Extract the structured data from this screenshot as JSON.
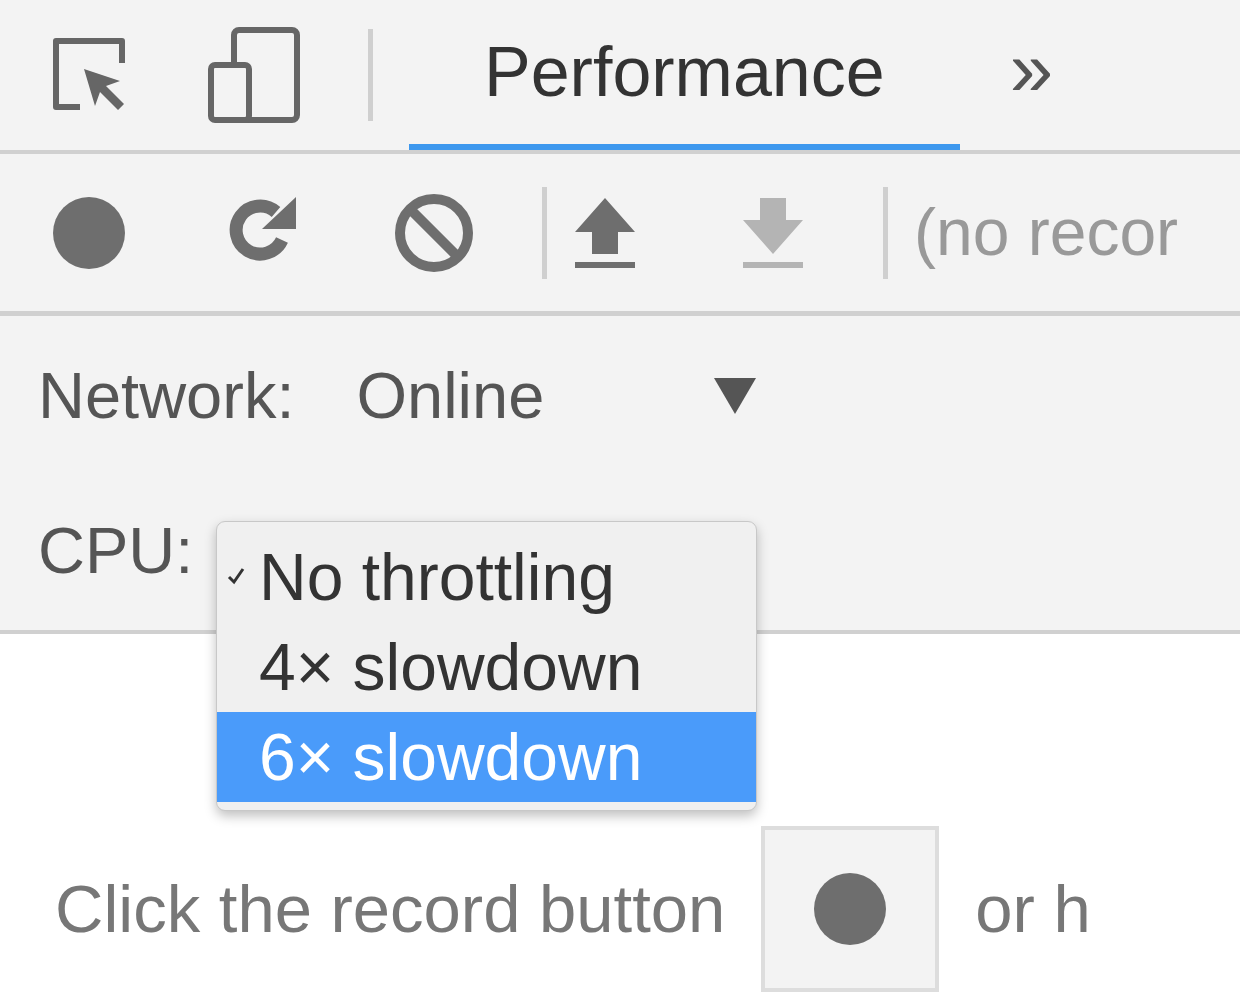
{
  "tabbar": {
    "tools": [
      {
        "kind": "inspect"
      },
      {
        "kind": "device"
      }
    ],
    "tabs": [
      {
        "label": "Performance",
        "selected": true
      }
    ],
    "more": "»"
  },
  "toolbar": {
    "groups": [
      [
        {
          "kind": "record",
          "disabled": false
        },
        {
          "kind": "reload",
          "disabled": false
        },
        {
          "kind": "clear",
          "disabled": false
        }
      ],
      [
        {
          "kind": "upload",
          "disabled": false
        },
        {
          "kind": "download",
          "disabled": true
        }
      ]
    ],
    "status": "(no recor"
  },
  "settings": {
    "network": {
      "label": "Network:",
      "value": "Online"
    },
    "cpu": {
      "label": "CPU:",
      "menu": [
        {
          "label": "No throttling",
          "checked": true,
          "selected": false
        },
        {
          "label": "4× slowdown",
          "checked": false,
          "selected": false
        },
        {
          "label": "6× slowdown",
          "checked": false,
          "selected": true
        }
      ]
    }
  },
  "hint": {
    "before": "Click the record button",
    "after": "or h"
  }
}
